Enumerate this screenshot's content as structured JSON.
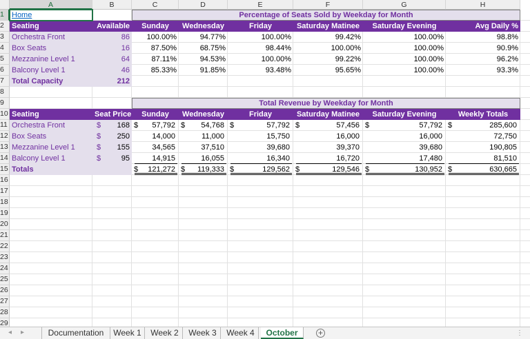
{
  "columns": [
    "A",
    "B",
    "C",
    "D",
    "E",
    "F",
    "G",
    "H"
  ],
  "rows": [
    "1",
    "2",
    "3",
    "4",
    "5",
    "6",
    "7",
    "8",
    "9",
    "10",
    "11",
    "12",
    "13",
    "14",
    "15",
    "16",
    "17",
    "18",
    "19",
    "20",
    "21",
    "22",
    "23",
    "24",
    "25",
    "26",
    "27",
    "28",
    "29"
  ],
  "home_link": "Home",
  "table1": {
    "title": "Percentage of Seats Sold by Weekday for Month",
    "headers": [
      "Seating",
      "Available",
      "Sunday",
      "Wednesday",
      "Friday",
      "Saturday Matinee",
      "Saturday Evening",
      "Avg Daily %"
    ],
    "rows": [
      [
        "Orchestra  Front",
        "86",
        "100.00%",
        "94.77%",
        "100.00%",
        "99.42%",
        "100.00%",
        "98.8%"
      ],
      [
        "Box Seats",
        "16",
        "87.50%",
        "68.75%",
        "98.44%",
        "100.00%",
        "100.00%",
        "90.9%"
      ],
      [
        "Mezzanine Level 1",
        "64",
        "87.11%",
        "94.53%",
        "100.00%",
        "99.22%",
        "100.00%",
        "96.2%"
      ],
      [
        "Balcony Level 1",
        "46",
        "85.33%",
        "91.85%",
        "93.48%",
        "95.65%",
        "100.00%",
        "93.3%"
      ]
    ],
    "total_label": "Total Capacity",
    "total_value": "212"
  },
  "table2": {
    "title": "Total Revenue by Weekday for Month",
    "headers": [
      "Seating",
      "Seat Price",
      "Sunday",
      "Wednesday",
      "Friday",
      "Saturday Matinee",
      "Saturday Evening",
      "Weekly Totals"
    ],
    "currency": "$",
    "rows": [
      [
        "Orchestra  Front",
        "168",
        "57,792",
        "54,768",
        "57,792",
        "57,456",
        "57,792",
        "285,600"
      ],
      [
        "Box Seats",
        "250",
        "14,000",
        "11,000",
        "15,750",
        "16,000",
        "16,000",
        "72,750"
      ],
      [
        "Mezzanine Level 1",
        "155",
        "34,565",
        "37,510",
        "39,680",
        "39,370",
        "39,680",
        "190,805"
      ],
      [
        "Balcony Level 1",
        "95",
        "14,915",
        "16,055",
        "16,340",
        "16,720",
        "17,480",
        "81,510"
      ]
    ],
    "total_label": "Totals",
    "totals": [
      "121,272",
      "119,333",
      "129,562",
      "129,546",
      "130,952",
      "630,665"
    ]
  },
  "tabs": [
    "Documentation",
    "Week 1",
    "Week 2",
    "Week 3",
    "Week 4",
    "October"
  ],
  "active_tab": "October",
  "add_sheet_symbol": "+",
  "nav_prev": "◂",
  "nav_next": "▸",
  "more_symbol": "⋮",
  "colors": {
    "purple": "#7030a0",
    "lavender": "#e4dfec",
    "excel_green": "#217346"
  }
}
